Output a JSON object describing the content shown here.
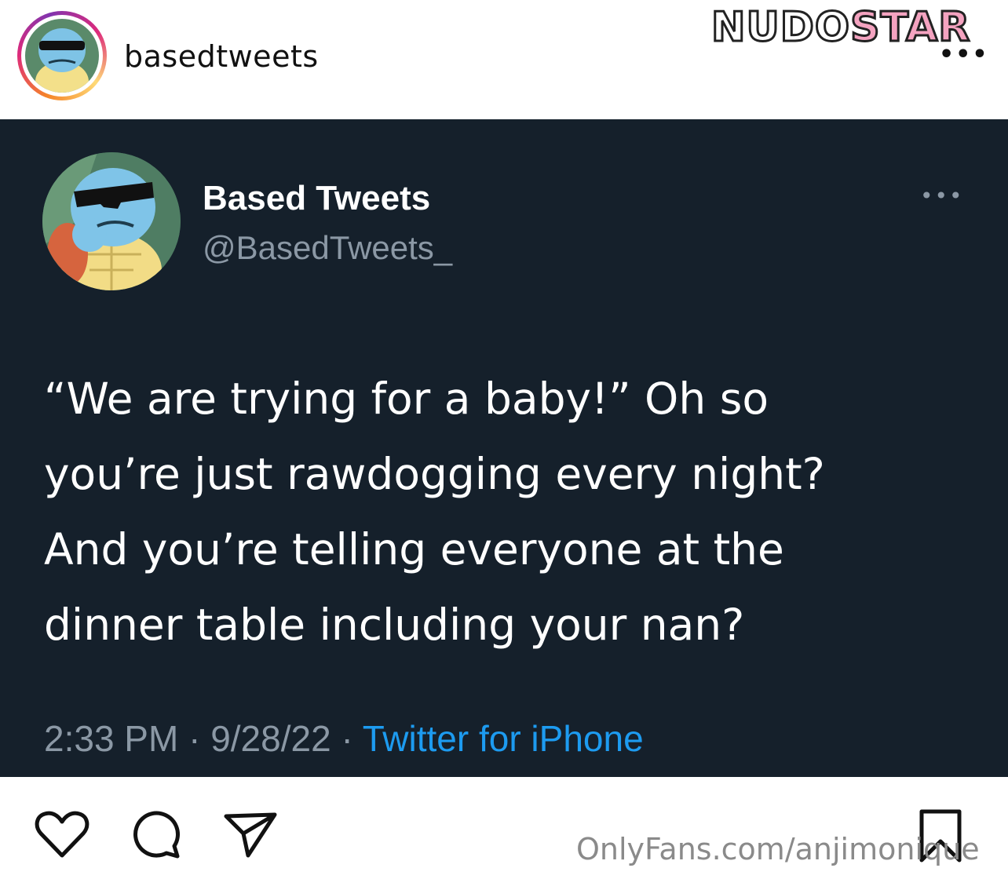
{
  "instagram": {
    "username": "basedtweets",
    "more_icon": "more-horizontal-icon",
    "avatar_icon": "squirtle-sunglasses-avatar"
  },
  "watermark": {
    "part1": "NUDO",
    "part2": "STAR",
    "bottom_text": "OnlyFans.com/anjimonique"
  },
  "tweet": {
    "display_name": "Based Tweets",
    "handle": "@BasedTweets_",
    "more_icon": "more-horizontal-icon",
    "text": "“We are trying for a baby!” Oh so\nyou’re just rawdogging every night?\nAnd you’re telling everyone at the\ndinner table including your nan?",
    "time_date": "2:33 PM · 9/28/22 · ",
    "source": "Twitter for iPhone"
  },
  "actions": {
    "like_icon": "heart-icon",
    "comment_icon": "comment-icon",
    "share_icon": "send-icon",
    "save_icon": "bookmark-icon"
  },
  "colors": {
    "tweet_background": "#15202b",
    "link_blue": "#1d9bf0",
    "muted_gray": "#8b98a5",
    "watermark_pink": "#f4a3c0"
  }
}
